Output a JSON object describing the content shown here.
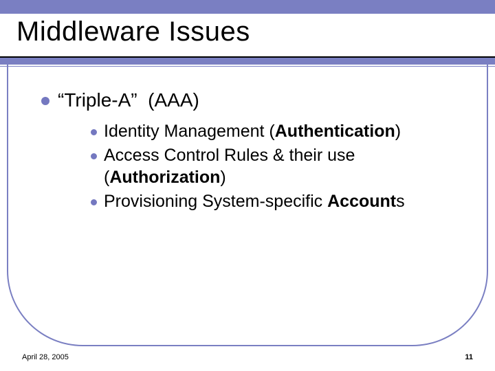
{
  "title": "Middleware Issues",
  "main_bullet": "“Triple-A”  (AAA)",
  "sub_bullets": [
    {
      "pre": "Identity Management (",
      "bold": "Authentication",
      "post": ")"
    },
    {
      "pre": "Access Control Rules & their use (",
      "bold": "Authorization",
      "post": ")"
    },
    {
      "pre": "Provisioning System-specific ",
      "bold": "Account",
      "post": "s"
    }
  ],
  "footer": {
    "date": "April 28, 2005",
    "page": "11"
  }
}
